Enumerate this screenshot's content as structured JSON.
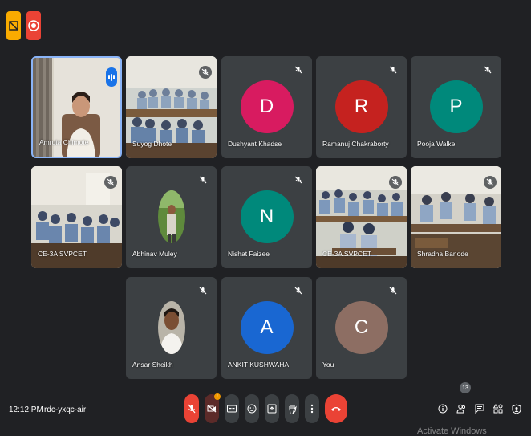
{
  "participants_count": "13",
  "tiles": [
    {
      "name": "Amruta Chimote",
      "kind": "video",
      "active": true
    },
    {
      "name": "Suyog Dhote",
      "kind": "video",
      "muted": true
    },
    {
      "name": "Dushyant Khadse",
      "kind": "letter",
      "letter": "D",
      "color": "#d81b60",
      "muted": true
    },
    {
      "name": "Ramanuj Chakraborty",
      "kind": "letter",
      "letter": "R",
      "color": "#c5221f",
      "muted": true
    },
    {
      "name": "Pooja Walke",
      "kind": "letter",
      "letter": "P",
      "color": "#00897b",
      "muted": true
    },
    {
      "name": "CE-3A SVPCET",
      "kind": "video",
      "muted": true
    },
    {
      "name": "Abhinav Muley",
      "kind": "photo",
      "muted": true
    },
    {
      "name": "Nishat Faizee",
      "kind": "letter",
      "letter": "N",
      "color": "#00897b",
      "muted": true
    },
    {
      "name": "CE-3A SVPCET",
      "kind": "video",
      "muted": true
    },
    {
      "name": "Shradha Banode",
      "kind": "video",
      "muted": true
    },
    {
      "name": "Ansar Sheikh",
      "kind": "photo",
      "muted": true
    },
    {
      "name": "ANKIT KUSHWAHA",
      "kind": "letter",
      "letter": "A",
      "color": "#1967d2",
      "muted": true
    },
    {
      "name": "You",
      "kind": "letter",
      "letter": "C",
      "color": "#8d6e63",
      "muted": true
    }
  ],
  "bottom_bar": {
    "time": "12:12 PM",
    "meeting_code": "rdc-yxqc-air",
    "camera_badge": "!"
  },
  "icons": [
    "presentation-icon",
    "record-icon",
    "mic-off-icon",
    "camera-off-icon",
    "captions-icon",
    "emoji-icon",
    "present-icon",
    "raise-hand-icon",
    "more-options-icon",
    "end-call-icon",
    "info-icon",
    "people-icon",
    "chat-icon",
    "activities-icon",
    "host-controls-icon"
  ],
  "watermark": "Activate Windows"
}
